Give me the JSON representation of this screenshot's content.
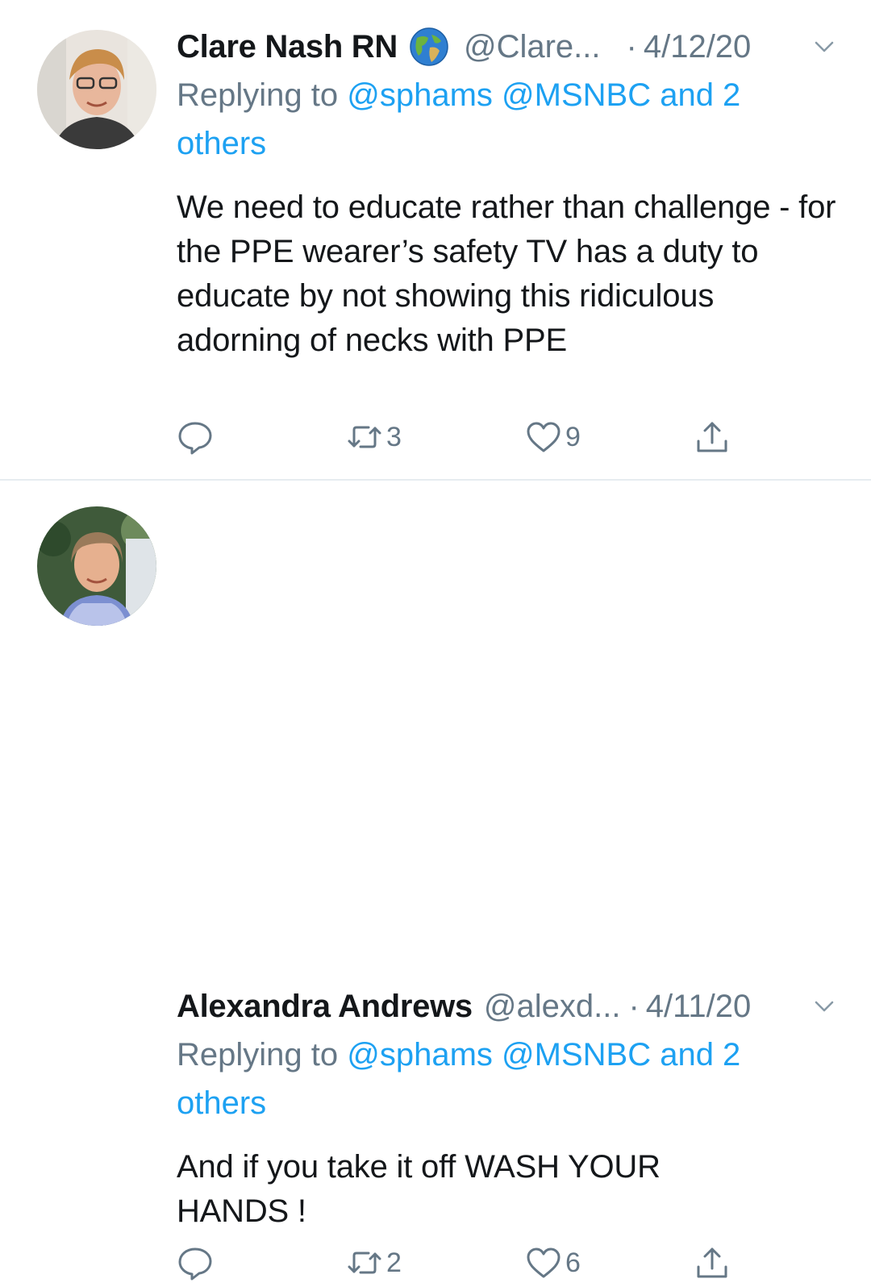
{
  "tweets": [
    {
      "name": "Clare Nash RN",
      "badge_icon": "globe-icon",
      "handle": "@Clare...",
      "separator": "·",
      "date": "4/12/20",
      "replying_prefix": "Replying to",
      "replying_links": "@sphams @MSNBC and 2 others",
      "text": "We need to educate rather than challenge -  for the PPE wearer’s safety TV has a duty to educate by not showing this ridiculous adorning of necks with PPE",
      "retweets": "3",
      "likes": "9"
    },
    {
      "name": "Alexandra Andrews",
      "handle": "@alexd...",
      "separator": "·",
      "date": "4/11/20",
      "replying_prefix": "Replying to",
      "replying_links": "@sphams @MSNBC and 2 others",
      "text": "And if you take it off WASH YOUR HANDS !",
      "retweets": "2",
      "likes": "6"
    }
  ],
  "colors": {
    "link": "#1da1f2",
    "secondary": "#657786",
    "text": "#14171a",
    "divider": "#e6ecf0"
  }
}
